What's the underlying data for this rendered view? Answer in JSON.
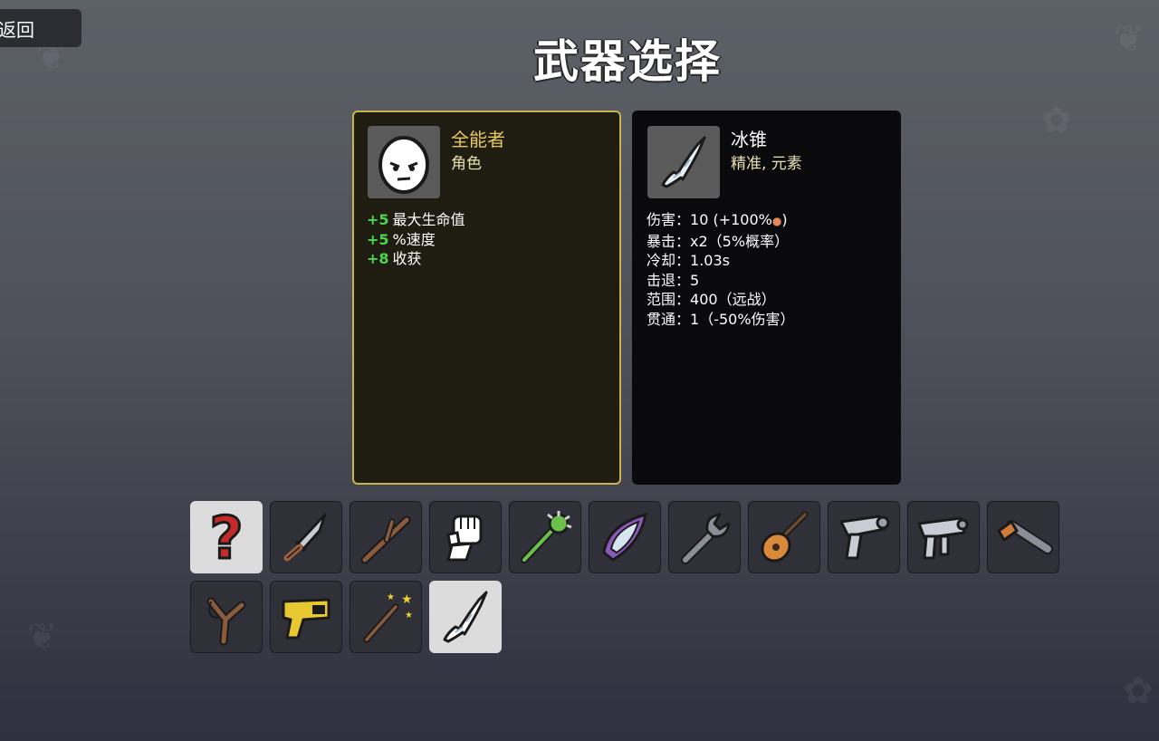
{
  "header": {
    "back_label": "返回",
    "title": "武器选择"
  },
  "character": {
    "name": "全能者",
    "type": "角色",
    "portrait_icon": "egg-face-icon",
    "stats": [
      {
        "value": "+5",
        "label": "最大生命值"
      },
      {
        "value": "+5",
        "label": "%速度"
      },
      {
        "value": "+8",
        "label": "收获"
      }
    ]
  },
  "weapon": {
    "name": "冰锥",
    "tags": "精准, 元素",
    "icon": "icicle-icon",
    "stats": [
      {
        "label": "伤害",
        "value": "10 (+100%",
        "suffix": ")"
      },
      {
        "label": "暴击",
        "value": "x2（5%概率）"
      },
      {
        "label": "冷却",
        "value": "1.03s"
      },
      {
        "label": "击退",
        "value": "5"
      },
      {
        "label": "范围",
        "value": "400（远战）"
      },
      {
        "label": "贯通",
        "value": "1（-50%伤害）"
      }
    ]
  },
  "weapon_slots": [
    {
      "icon": "random-question-icon",
      "selected": true
    },
    {
      "icon": "knife-icon",
      "selected": false
    },
    {
      "icon": "stick-icon",
      "selected": false
    },
    {
      "icon": "fist-icon",
      "selected": false
    },
    {
      "icon": "spiked-club-icon",
      "selected": false
    },
    {
      "icon": "crystal-shard-icon",
      "selected": false
    },
    {
      "icon": "wrench-icon",
      "selected": false
    },
    {
      "icon": "lute-icon",
      "selected": false
    },
    {
      "icon": "raygun-icon",
      "selected": false
    },
    {
      "icon": "smg-icon",
      "selected": false
    },
    {
      "icon": "double-barrel-icon",
      "selected": false
    },
    {
      "icon": "slingshot-icon",
      "selected": false
    },
    {
      "icon": "taser-icon",
      "selected": false
    },
    {
      "icon": "magic-wand-icon",
      "selected": false
    },
    {
      "icon": "icicle-icon",
      "selected": true
    }
  ],
  "colors": {
    "character_border": "#c8b44a",
    "character_name": "#e8c85a",
    "stat_positive": "#4cd64c",
    "slot_selected": "#dcdcdc"
  }
}
